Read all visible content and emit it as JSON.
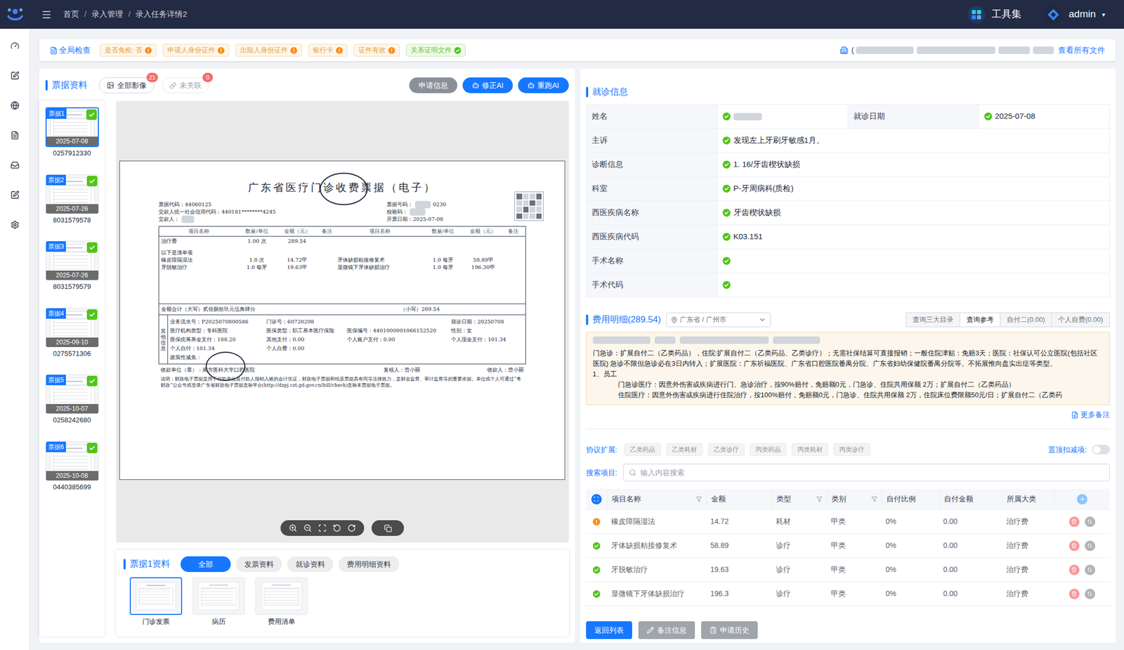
{
  "topbar": {
    "breadcrumb": [
      "首页",
      "录入管理",
      "录入任务详情2"
    ],
    "separator": "/",
    "tools": "工具集",
    "user": "admin",
    "caret": "▾"
  },
  "check_bar": {
    "title": "全局检查",
    "tags": [
      {
        "label": "是否免检: 否",
        "ok": false
      },
      {
        "label": "申请人身份证件",
        "ok": false
      },
      {
        "label": "出险人身份证件",
        "ok": false
      },
      {
        "label": "银行卡",
        "ok": false
      },
      {
        "label": "证件有效",
        "ok": false
      },
      {
        "label": "关系证明文件",
        "ok": true
      }
    ],
    "file_prefix": "(",
    "view_all": "查看所有文件"
  },
  "bills_panel": {
    "title": "票据资料",
    "filters": [
      {
        "label": "全部影像",
        "badge": "21",
        "disabled": false
      },
      {
        "label": "未关联",
        "badge": "0",
        "disabled": true
      }
    ],
    "actions": [
      {
        "label": "申请信息",
        "kind": "gray"
      },
      {
        "label": "修正AI",
        "kind": "ai"
      },
      {
        "label": "重跑AI",
        "kind": "ai"
      }
    ],
    "bills": [
      {
        "label": "票据1",
        "date": "2025-07-08",
        "number": "0257912330",
        "selected": true,
        "checked": true
      },
      {
        "label": "票据2",
        "date": "2025-07-26",
        "number": "8031579578",
        "selected": false,
        "checked": true
      },
      {
        "label": "票据3",
        "date": "2025-07-26",
        "number": "8031579579",
        "selected": false,
        "checked": true
      },
      {
        "label": "票据4",
        "date": "2025-09-10",
        "number": "0275571306",
        "selected": false,
        "checked": true
      },
      {
        "label": "票据5",
        "date": "2025-10-07",
        "number": "0258242680",
        "selected": false,
        "checked": true
      },
      {
        "label": "票据6",
        "date": "2025-10-08",
        "number": "0440385699",
        "selected": false,
        "checked": true
      }
    ]
  },
  "invoice": {
    "title": "广东省医疗门诊收费票据（电子）",
    "meta_left": [
      {
        "label": "票据代码：44060125",
        "masked": false,
        "value": ""
      },
      {
        "label": "交款人统一社会信用代码：440181********4245",
        "masked": false,
        "value": ""
      },
      {
        "label": "交款人：",
        "masked": true,
        "value": ""
      }
    ],
    "meta_right": [
      {
        "label": "票据号码：",
        "masked": true,
        "value": "0230"
      },
      {
        "label": "校验码：",
        "masked": true,
        "value": ""
      },
      {
        "label": "开票日期：2025-07-08",
        "masked": false,
        "value": ""
      }
    ],
    "columns": [
      "项目名称",
      "数量/单位",
      "金额（元）",
      "备注",
      "项目名称",
      "数量/单位",
      "金额（元）",
      "备注"
    ],
    "rows": [
      {
        "kind": "item",
        "text": "",
        "cells": [
          "治疗费",
          "1.00 次",
          "289.54",
          "",
          "",
          "",
          "",
          ""
        ]
      },
      {
        "kind": "note",
        "text": "以下是清单项",
        "cells": []
      },
      {
        "kind": "item",
        "text": "",
        "cells": [
          "橡皮障隔湿法",
          "1.0 次",
          "14.72甲",
          "",
          "牙体缺损粘接修复术",
          "1.0 每牙",
          "58.89甲",
          ""
        ]
      },
      {
        "kind": "item",
        "text": "",
        "cells": [
          "牙脱敏治疗",
          "1.0 每牙",
          "19.63甲",
          "",
          "显微镜下牙体缺损治疗",
          "1.0 每牙",
          "196.30甲",
          ""
        ]
      }
    ],
    "total_upper": "金额合计（大写）贰佰捌拾玖元伍角肆分",
    "total_lower": "（小写）289.54",
    "side_label": "其他信息",
    "info": [
      [
        "业务流水号：P2025070800586",
        "门诊号：60720298",
        "",
        "就诊日期：20250708"
      ],
      [
        "医疗机构类型：专科医院",
        "医保类型：职工基本医疗保险",
        "医保编号：4401000001066152520",
        "性别：女"
      ],
      [
        "医保统筹基金支付：188.20",
        "其他支付：0.00",
        "个人账户支付：0.00",
        "个人现金支付：101.34"
      ],
      [
        "个人自付：101.34",
        "个人自费：0.00",
        "",
        ""
      ],
      [
        "政策性减免：",
        "",
        "",
        ""
      ]
    ],
    "signers": [
      "收款单位（章）：南方医科大学口腔医院",
      "复核人：曾小丽",
      "收款人：曾小丽"
    ],
    "note": "说明：财政电子票据是用于付款单位及付款人报销入账的会计凭证，财政电子票据和纸质票据具有同等法律效力，是财会监督、审计监督等的重要依据。单位或个人可通过“粤财政”公众号或登录广东省财政电子票据查验平台(http://dzpj.czt.gd.gov.cn/bill/check)查验本票据电子票据。"
  },
  "bill_detail": {
    "title": "票据1资料",
    "tabs": [
      {
        "label": "全部",
        "selected": true
      },
      {
        "label": "发票资料",
        "selected": false
      },
      {
        "label": "就诊资料",
        "selected": false
      },
      {
        "label": "费用明细资料",
        "selected": false
      }
    ],
    "images": [
      {
        "label": "门诊发票",
        "selected": true
      },
      {
        "label": "病历",
        "selected": false
      },
      {
        "label": "费用清单",
        "selected": false
      }
    ]
  },
  "visit": {
    "title": "就诊信息",
    "rows": [
      {
        "cells": [
          {
            "label": "姓名",
            "value": "",
            "masked": true,
            "ok": true
          },
          {
            "label": "就诊日期",
            "value": "2025-07-08",
            "masked": false,
            "ok": true
          }
        ]
      },
      {
        "cells": [
          {
            "label": "主诉",
            "value": "发现左上牙刷牙敏感1月。",
            "masked": false,
            "ok": true
          }
        ]
      },
      {
        "cells": [
          {
            "label": "诊断信息",
            "value": "1. 16/牙齿楔状缺损",
            "masked": false,
            "ok": true
          }
        ]
      },
      {
        "cells": [
          {
            "label": "科室",
            "value": "P-牙周病科(质检)",
            "masked": false,
            "ok": true
          }
        ]
      },
      {
        "cells": [
          {
            "label": "西医疾病名称",
            "value": "牙齿楔状缺损",
            "masked": false,
            "ok": true
          }
        ]
      },
      {
        "cells": [
          {
            "label": "西医疾病代码",
            "value": "K03.151",
            "masked": false,
            "ok": true
          }
        ]
      },
      {
        "cells": [
          {
            "label": "手术名称",
            "value": "",
            "masked": false,
            "ok": true
          }
        ]
      },
      {
        "cells": [
          {
            "label": "手术代码",
            "value": "",
            "masked": false,
            "ok": true
          }
        ]
      }
    ]
  },
  "fees": {
    "title": "费用明细(289.54)",
    "region": "广东省 / 广州市",
    "queries": [
      {
        "label": "查询三大目录",
        "selected": false
      },
      {
        "label": "查询参考",
        "selected": true
      },
      {
        "label": "自付二(0.00)",
        "selected": false
      },
      {
        "label": "个人自费(0.00)",
        "selected": false
      }
    ],
    "notes": {
      "masked_header": true,
      "paragraphs": [
        {
          "text": "门急诊：扩展自付二（乙类药品），住院:扩展自付二（乙类药品、乙类诊疗）；无需社保结算可直接报销；一般住院津贴：免赔3天；医院：社保认可公立医院(包括社区医院) 急诊不限但急诊必在3日内转入；扩展医院：广东祈福医院、广东省口腔医院番禺分院、广东省妇幼保健院番禺分院等。不拓展惟向盘实出症等类型。",
          "indent": false
        },
        {
          "text": "1、员工",
          "indent": false
        },
        {
          "text": "门急诊医疗：因意外伤害或疾病进行门、急诊治疗，按90%赔付，免赔额0元，门急诊、住院共用保额 2万；扩展自付二（乙类药品）",
          "indent": true
        },
        {
          "text": "住院医疗：因意外伤害或疾病进行住院治疗，按100%赔付，免赔额0元，门急诊、住院共用保额 2万，住院床位费限额50元/日；扩展自付二（乙类药",
          "indent": true
        }
      ],
      "more": "更多备注"
    },
    "extensions": {
      "label": "协议扩展:",
      "tags": [
        "乙类药品",
        "乙类耗材",
        "乙类诊疗",
        "丙类药品",
        "丙类耗材",
        "丙类诊疗"
      ],
      "pin_label": "置顶扣减项:",
      "pin_on": false
    },
    "search": {
      "label": "搜索项目:",
      "placeholder": "输入内容搜索"
    },
    "columns": [
      {
        "label": "项目名称",
        "filter": true
      },
      {
        "label": "金额",
        "filter": false
      },
      {
        "label": "类型",
        "filter": true
      },
      {
        "label": "类别",
        "filter": true
      },
      {
        "label": "自付比例",
        "filter": false
      },
      {
        "label": "自付金额",
        "filter": false
      },
      {
        "label": "所属大类",
        "filter": false
      }
    ],
    "rows": [
      {
        "ok": false,
        "name": "橡皮障隔湿法",
        "amount": "14.72",
        "type": "耗材",
        "category": "甲类",
        "ratio": "0%",
        "self_amount": "0.00",
        "group": "治疗费"
      },
      {
        "ok": true,
        "name": "牙体缺损粘接修复术",
        "amount": "58.89",
        "type": "诊疗",
        "category": "甲类",
        "ratio": "0%",
        "self_amount": "0.00",
        "group": "治疗费"
      },
      {
        "ok": true,
        "name": "牙脱敏治疗",
        "amount": "19.63",
        "type": "诊疗",
        "category": "甲类",
        "ratio": "0%",
        "self_amount": "0.00",
        "group": "治疗费"
      },
      {
        "ok": true,
        "name": "显微镜下牙体缺损治疗",
        "amount": "196.3",
        "type": "诊疗",
        "category": "甲类",
        "ratio": "0%",
        "self_amount": "0.00",
        "group": "治疗费"
      }
    ]
  },
  "footer": {
    "buttons": [
      {
        "label": "返回列表",
        "kind": "primary"
      },
      {
        "label": "备注信息",
        "kind": "gray"
      },
      {
        "label": "申请历史",
        "kind": "gray"
      }
    ]
  }
}
